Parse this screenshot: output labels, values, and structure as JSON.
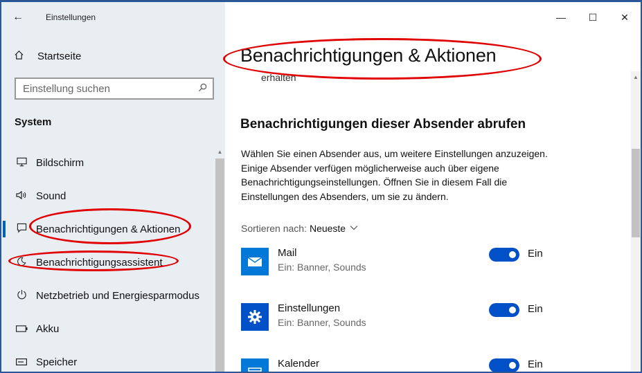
{
  "window": {
    "app_title": "Einstellungen",
    "controls": {
      "minimize": "—",
      "maximize": "☐",
      "close": "✕"
    }
  },
  "sidebar": {
    "back_icon": "←",
    "home_label": "Startseite",
    "search_placeholder": "Einstellung suchen",
    "section_label": "System",
    "items": [
      {
        "label": "Bildschirm",
        "icon": "display-icon"
      },
      {
        "label": "Sound",
        "icon": "speaker-icon"
      },
      {
        "label": "Benachrichtigungen & Aktionen",
        "icon": "notification-icon",
        "active": true
      },
      {
        "label": "Benachrichtigungsassistent",
        "icon": "moon-icon"
      },
      {
        "label": "Netzbetrieb und Energiesparmodus",
        "icon": "power-icon"
      },
      {
        "label": "Akku",
        "icon": "battery-icon"
      },
      {
        "label": "Speicher",
        "icon": "storage-icon"
      }
    ]
  },
  "main": {
    "title": "Benachrichtigungen & Aktionen",
    "cut_text": "erhalten",
    "subtitle": "Benachrichtigungen dieser Absender abrufen",
    "description": "Wählen Sie einen Absender aus, um weitere Einstellungen anzuzeigen. Einige Absender verfügen möglicherweise auch über eigene Benachrichtigungseinstellungen. Öffnen Sie in diesem Fall die Einstellungen des Absenders, um sie zu ändern.",
    "sort_label": "Sortieren nach:",
    "sort_value": "Neueste",
    "apps": [
      {
        "name": "Mail",
        "sub": "Ein: Banner, Sounds",
        "state": "Ein",
        "icon": "mail-icon",
        "color": "#0078d7"
      },
      {
        "name": "Einstellungen",
        "sub": "Ein: Banner, Sounds",
        "state": "Ein",
        "icon": "gear-icon",
        "color": "#0050c8"
      },
      {
        "name": "Kalender",
        "sub": "",
        "state": "Ein",
        "icon": "calendar-icon",
        "color": "#0078d7"
      }
    ]
  },
  "colors": {
    "accent": "#0050c8",
    "annotation": "#e00000",
    "sidebar_bg": "#e9eef3"
  }
}
